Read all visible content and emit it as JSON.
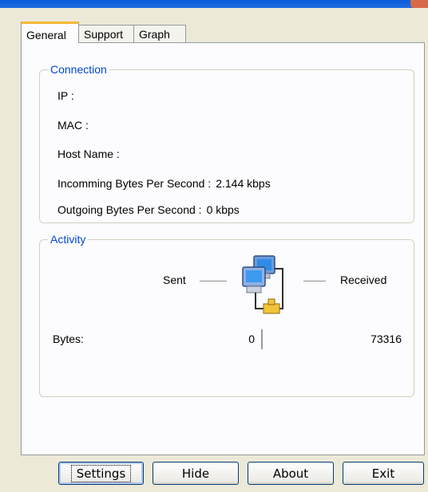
{
  "tabs": [
    {
      "label": "General",
      "active": true
    },
    {
      "label": "Support",
      "active": false
    },
    {
      "label": "Graph",
      "active": false
    }
  ],
  "connection": {
    "title": "Connection",
    "rows": [
      {
        "label": "IP :",
        "value": ""
      },
      {
        "label": "MAC :",
        "value": ""
      },
      {
        "label": "Host Name :",
        "value": ""
      },
      {
        "label": "Incomming Bytes Per Second :",
        "value": "2.144 kbps"
      },
      {
        "label": "Outgoing Bytes Per Second :",
        "value": "0 kbps"
      }
    ]
  },
  "activity": {
    "title": "Activity",
    "sent_label": "Sent",
    "received_label": "Received",
    "bytes_label": "Bytes:",
    "sent_value": "0",
    "received_value": "73316"
  },
  "buttons": {
    "settings": "Settings",
    "hide": "Hide",
    "about": "About",
    "exit": "Exit"
  },
  "icons": {
    "network": "network-computers-icon"
  },
  "colors": {
    "group_title": "#0046d5",
    "active_tab_accent": "#f5b836",
    "button_border": "#003c74"
  }
}
